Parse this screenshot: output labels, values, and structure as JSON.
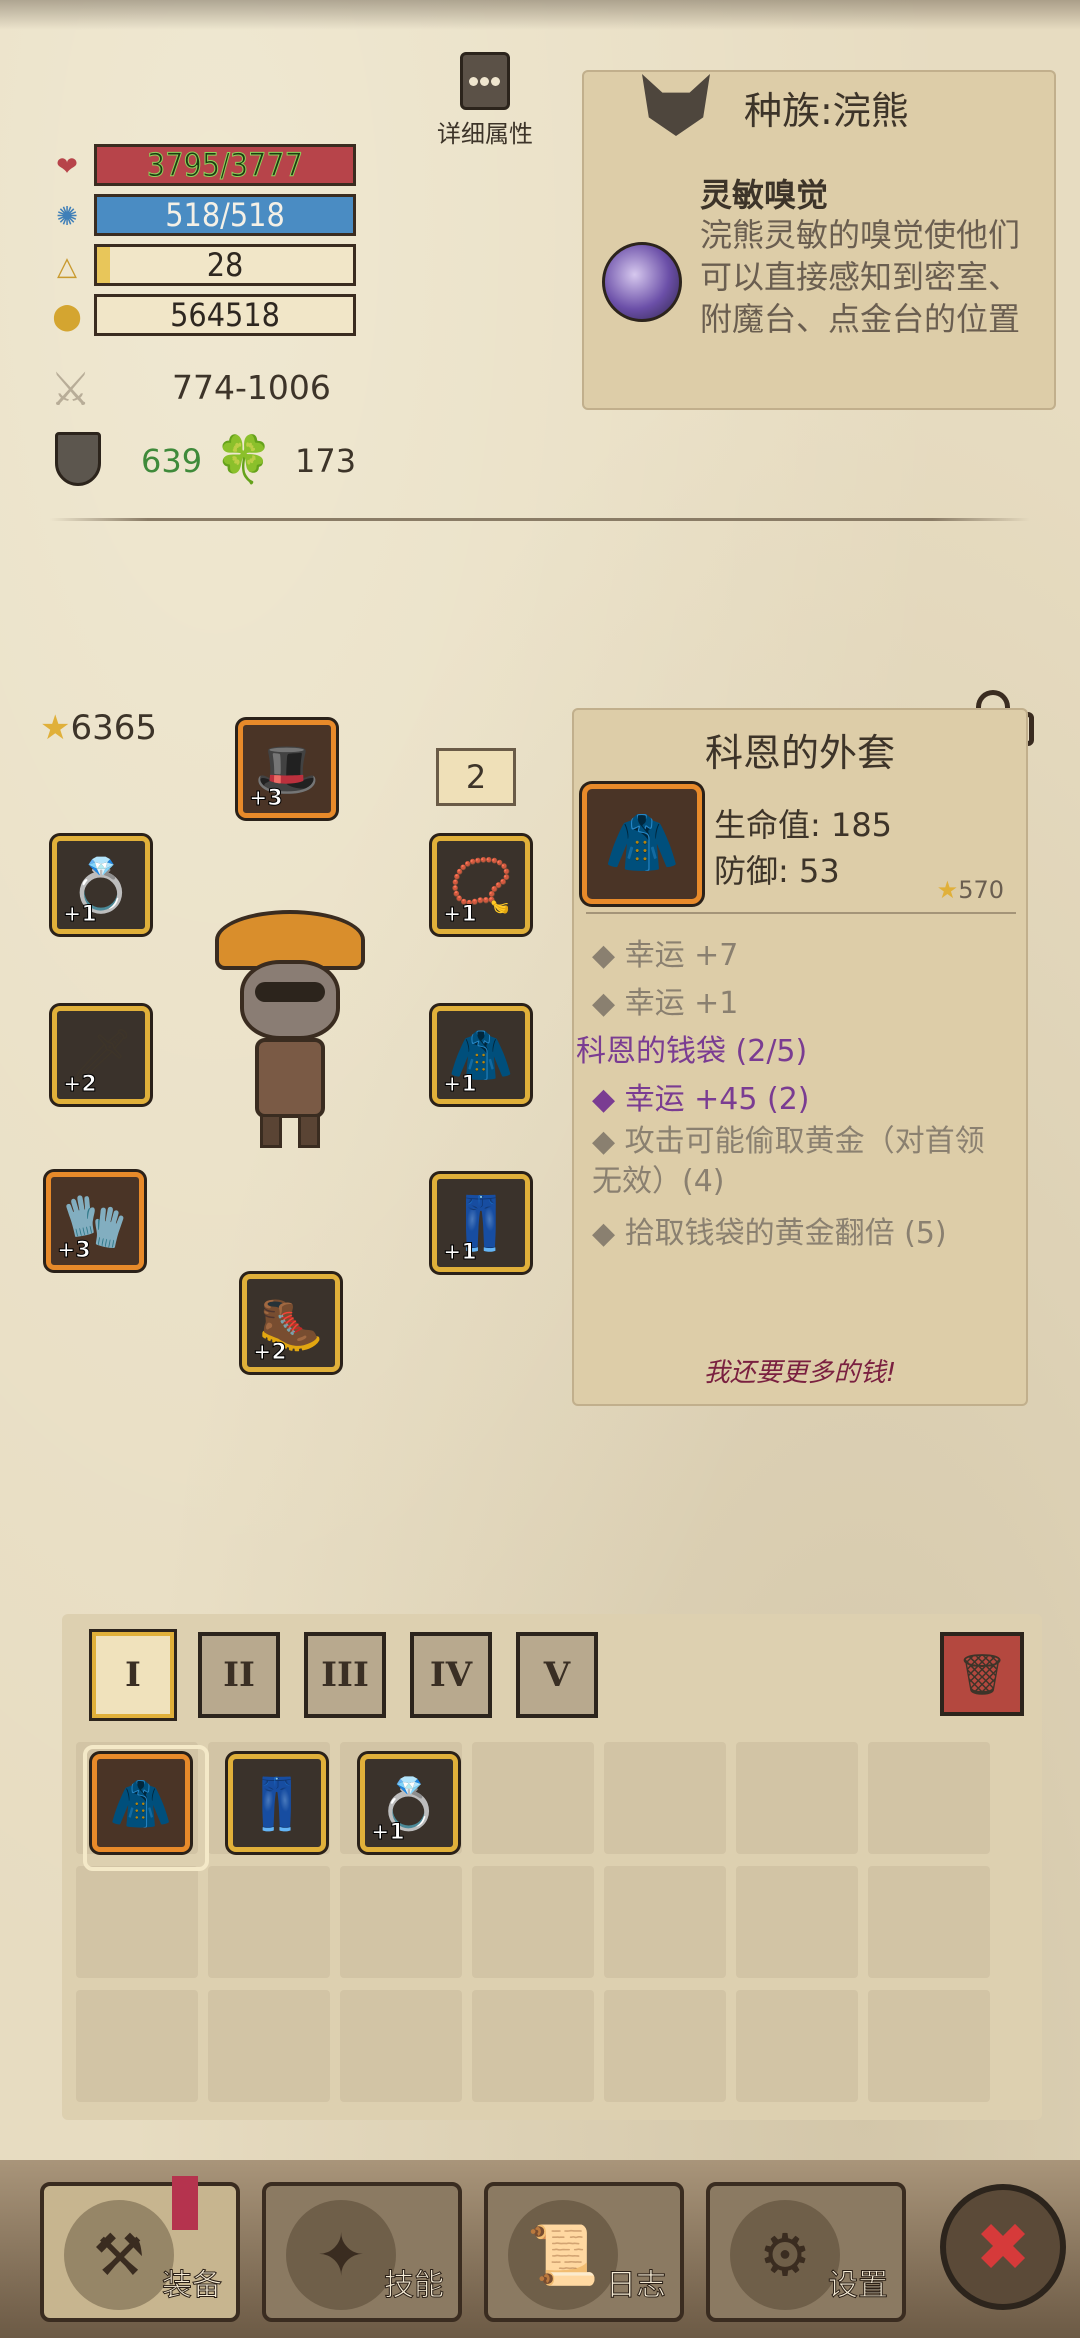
{
  "stats": {
    "hp": "3795/3777",
    "hp_fill": 1.0,
    "mp": "518/518",
    "mp_fill": 1.0,
    "level": "28",
    "level_fill": 0.05,
    "gold": "564518",
    "attack": "774-1006",
    "defense": "639",
    "luck": "173"
  },
  "detail": {
    "label": "详细属性"
  },
  "race": {
    "title": "种族:浣熊",
    "skill_title": "灵敏嗅觉",
    "skill_desc": "浣熊灵敏的嗅觉使他们可以直接感知到密室、附魔台、点金台的位置"
  },
  "equipment": {
    "power": "6365",
    "page": "2",
    "slots": [
      {
        "name": "hat",
        "plus": "+3",
        "glyph": "🎩"
      },
      {
        "name": "ring-left",
        "plus": "+1",
        "glyph": "💍"
      },
      {
        "name": "weapon",
        "plus": "+2",
        "glyph": "🗡"
      },
      {
        "name": "gloves",
        "plus": "+3",
        "glyph": "🧤"
      },
      {
        "name": "boots",
        "plus": "+2",
        "glyph": "🥾"
      },
      {
        "name": "amulet",
        "plus": "+1",
        "glyph": "📿"
      },
      {
        "name": "armor",
        "plus": "+1",
        "glyph": "🧥"
      },
      {
        "name": "pants",
        "plus": "+1",
        "glyph": "👖"
      }
    ]
  },
  "item": {
    "title": "科恩的外套",
    "hp": "生命值: 185",
    "def": "防御: 53",
    "stars": "570",
    "lines": [
      {
        "text": "◆ 幸运 +7",
        "style": "dim"
      },
      {
        "text": "◆ 幸运 +1",
        "style": "dim"
      },
      {
        "text": "科恩的钱袋 (2/5)",
        "style": "purple"
      },
      {
        "text": "◆ 幸运 +45 (2)",
        "style": "purple"
      },
      {
        "text": "◆ 攻击可能偷取黄金（对首领无效）(4)",
        "style": "dim"
      },
      {
        "text": "◆ 拾取钱袋的黄金翻倍 (5)",
        "style": "dim"
      }
    ],
    "quote": "我还要更多的钱!"
  },
  "bag": {
    "tabs": [
      "I",
      "II",
      "III",
      "IV",
      "V"
    ],
    "items": [
      {
        "glyph": "🧥",
        "plus": ""
      },
      {
        "glyph": "👖",
        "plus": ""
      },
      {
        "glyph": "💍",
        "plus": "+1"
      }
    ]
  },
  "nav": {
    "equip": "装备",
    "skills": "技能",
    "log": "日志",
    "settings": "设置"
  }
}
